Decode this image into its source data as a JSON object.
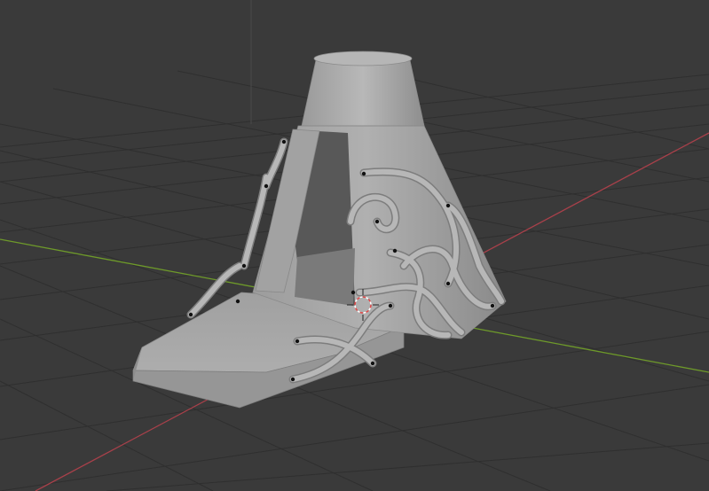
{
  "app": "3D viewport",
  "viewport": {
    "background": "#3a3a3a",
    "grid_color": "#2e2e2e",
    "x_axis_color": "#a8404a",
    "y_axis_color": "#6e9a2a",
    "model_color": "#a9a9a9",
    "model_name": "",
    "cursor": "3d-cursor-icon"
  }
}
